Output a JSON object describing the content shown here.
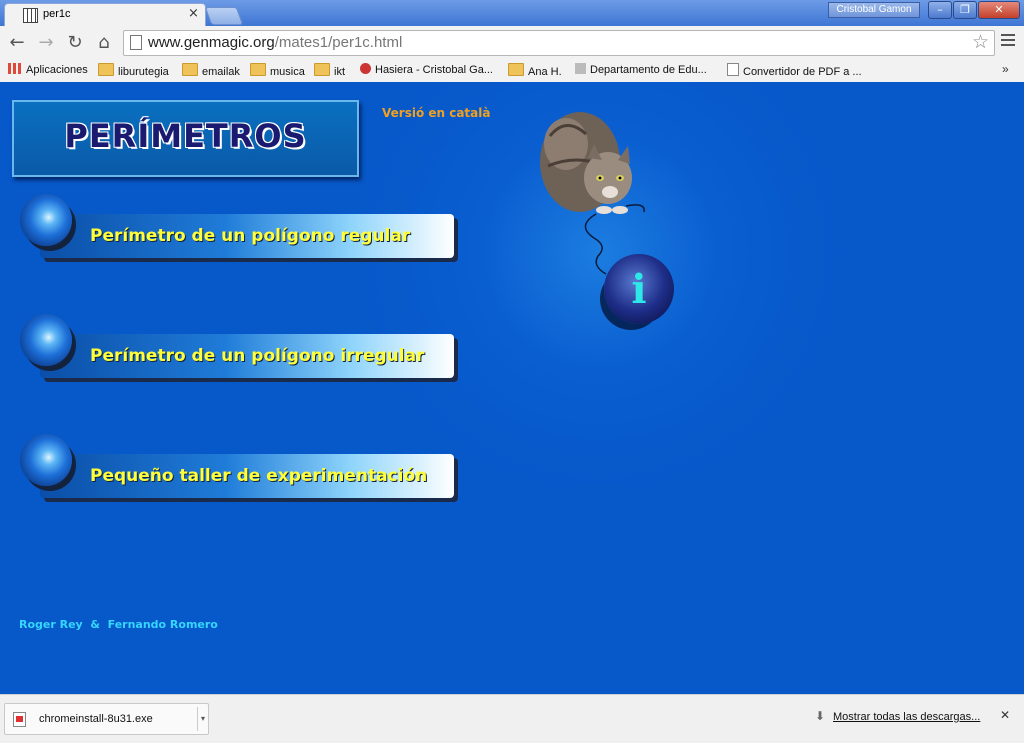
{
  "browser": {
    "tab_title": "per1c",
    "tab_close": "×",
    "user_name": "Cristobal Gamon",
    "window_buttons": [
      "–",
      "❐",
      "✕"
    ],
    "nav": {
      "back": "←",
      "forward": "→",
      "reload": "↻",
      "home": "⌂"
    },
    "url_domain": "www.genmagic.org",
    "url_path": "/mates1/per1c.html",
    "bookmark_star": "☆"
  },
  "bookmarks": {
    "items": [
      "Aplicaciones",
      "liburutegia",
      "emailak",
      "musica",
      "ikt",
      "Hasiera - Cristobal Ga...",
      "Ana H.",
      "Departamento de Edu...",
      "Convertidor de PDF a ..."
    ],
    "more": "»"
  },
  "page": {
    "banner_title": "PERÍMETROS",
    "language_link": "Versió en català",
    "menu": [
      "Perímetro de un polígono regular",
      "Perímetro de un polígono irregular",
      "Pequeño taller de experimentación"
    ],
    "info_letter": "i",
    "authors": "Roger Rey  &  Fernando Romero"
  },
  "downloads": {
    "file_name": "chromeinstall-8u31.exe",
    "dropdown": "▾",
    "show_all": "Mostrar todas las descargas...",
    "close": "✕"
  },
  "colors": {
    "page_background": "#0758c9",
    "menu_text": "#ffff3a",
    "language_link": "#f0a020",
    "authors_text": "#35d6ff",
    "banner_text": "#1a1a70"
  }
}
